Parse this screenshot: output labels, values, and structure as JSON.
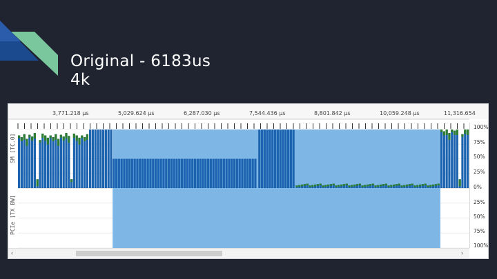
{
  "slide": {
    "title_line1": "Original - 6183us",
    "title_line2": "4k"
  },
  "profiler": {
    "row_labels": [
      "SM [TC.0]",
      "PCIe [TX BW]"
    ],
    "time_ticks": [
      "3,771.218 µs",
      "5,029.624 µs",
      "6,287.030 µs",
      "7,544.436 µs",
      "8,801.842 µs",
      "10,059.248 µs",
      "11,316.654"
    ],
    "upper_pct_ticks": [
      "100%",
      "75%",
      "50%",
      "25%",
      "0%"
    ],
    "lower_pct_ticks": [
      "25%",
      "50%",
      "75%",
      "100%"
    ],
    "selection_color": "#7eb6e6",
    "bar_color": "#1c64b0",
    "highlight_bar_color": "#2e7d32",
    "scroll_left_icon": "chevron-left-icon",
    "scroll_right_icon": "chevron-right-icon"
  },
  "chart_data": {
    "type": "bar",
    "ylabel": "SM [TC.0]",
    "ylim": [
      0,
      100
    ],
    "x_range_us": [
      3144,
      11946
    ],
    "selection_us": [
      4990,
      11380
    ],
    "segments": [
      {
        "from_us": 3144,
        "to_us": 4530,
        "level_pct": 90,
        "note": "green-topped bars"
      },
      {
        "from_us": 4530,
        "to_us": 4990,
        "level_pct": 100
      },
      {
        "from_us": 4990,
        "to_us": 7830,
        "level_pct": 50
      },
      {
        "from_us": 7830,
        "to_us": 8560,
        "level_pct": 100
      },
      {
        "from_us": 8560,
        "to_us": 11380,
        "level_pct": 6
      },
      {
        "from_us": 11380,
        "to_us": 11946,
        "level_pct": 100,
        "note": "green-topped bars"
      }
    ]
  }
}
